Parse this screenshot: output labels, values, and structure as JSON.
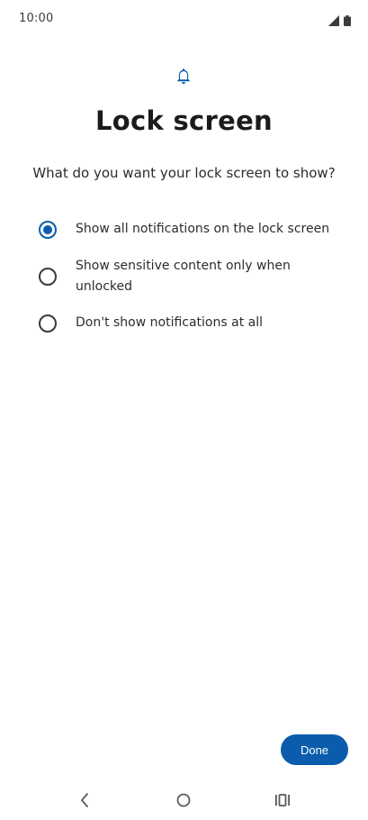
{
  "status_bar": {
    "time": "10:00",
    "icons": [
      "signal-icon",
      "battery-icon"
    ]
  },
  "header": {
    "icon": "bell-icon",
    "title": "Lock screen",
    "subtitle": "What do you want your lock screen to show?"
  },
  "options": [
    {
      "label": "Show all notifications on the lock screen",
      "selected": true
    },
    {
      "label": "Show sensitive content only when unlocked",
      "selected": false
    },
    {
      "label": "Don't show notifications at all",
      "selected": false
    }
  ],
  "actions": {
    "done_label": "Done"
  },
  "nav_bar": {
    "icons": [
      "back-icon",
      "home-icon",
      "recents-icon"
    ]
  },
  "colors": {
    "accent": "#0b5cad",
    "text": "#1f1f1f",
    "background": "#ffffff"
  }
}
